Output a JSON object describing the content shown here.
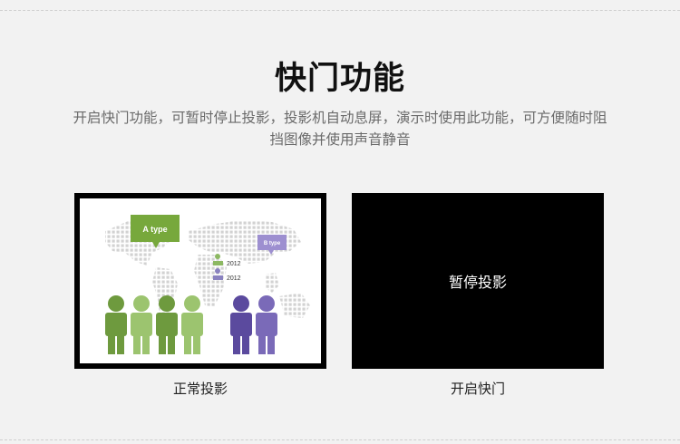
{
  "header": {
    "title": "快门功能",
    "description": "开启快门功能，可暂时停止投影，投影机自动息屏，演示时使用此功能，可方便随时阻挡图像并使用声音静音"
  },
  "normal_panel": {
    "caption": "正常投影",
    "bubble_a": "A type",
    "bubble_b": "B type",
    "legend_green": "2012",
    "legend_purple": "2012"
  },
  "shutter_panel": {
    "text": "暂停投影",
    "caption": "开启快门"
  },
  "colors": {
    "background": "#f2f2f2",
    "green": "#7aa83e",
    "purple": "#7a6ab8",
    "black": "#000000"
  }
}
